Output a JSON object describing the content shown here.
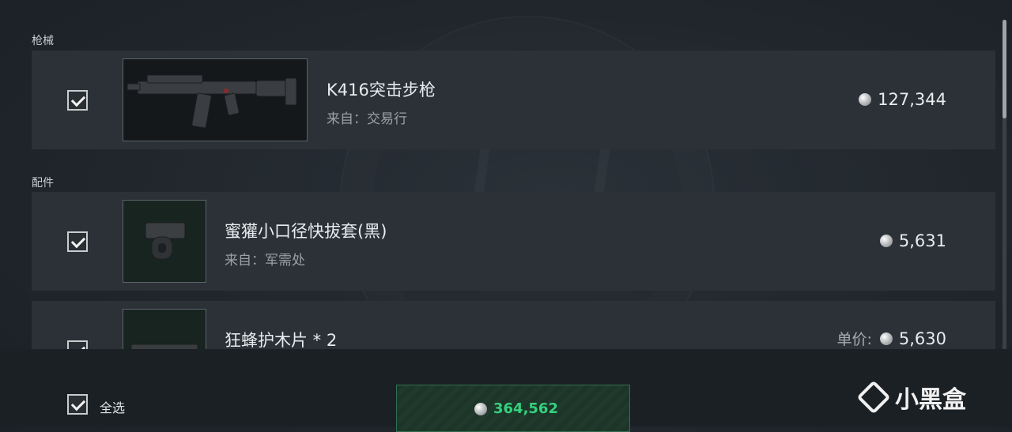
{
  "sections": {
    "firearms_label": "枪械",
    "attachments_label": "配件"
  },
  "items": [
    {
      "name": "K416突击步枪",
      "source": "来自：交易行",
      "price": "127,344",
      "checked": true
    },
    {
      "name": "蜜獾小口径快拔套(黑)",
      "source": "来自：军需处",
      "price": "5,631",
      "checked": true
    },
    {
      "name": "狂蜂护木片 * 2",
      "unit_label": "单价:",
      "price": "5,630",
      "checked": true
    }
  ],
  "footer": {
    "select_all_label": "全选",
    "total": "364,562"
  },
  "watermark": {
    "text": "小黑盒"
  },
  "colors": {
    "accent_green": "#35d17d",
    "row_bg": "#2b3137"
  },
  "icons": [
    "checkbox-icon",
    "coin-icon",
    "rifle-image",
    "muzzle-image",
    "handguard-image"
  ]
}
